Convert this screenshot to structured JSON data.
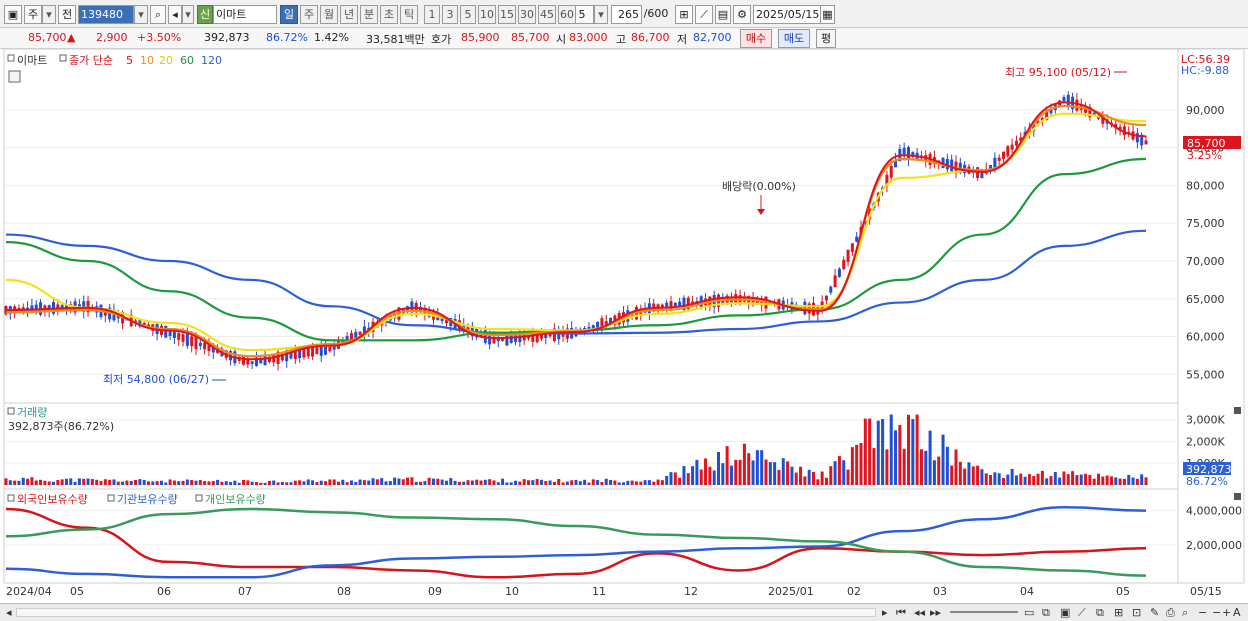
{
  "toolbar": {
    "type_label": "주",
    "prev_label": "전",
    "code": "139480",
    "new_badge": "신",
    "stock_name": "이마트",
    "periods": [
      "일",
      "주",
      "월",
      "년",
      "분",
      "초",
      "틱"
    ],
    "active_period": "일",
    "intervals": [
      "1",
      "3",
      "5",
      "10",
      "15",
      "30",
      "45",
      "60"
    ],
    "interval_value": "5",
    "count_value": "265",
    "count_total": "/600",
    "date_value": "2025/05/15"
  },
  "quote": {
    "price": "85,700",
    "up_arrow": "▲",
    "change": "2,900",
    "change_pct": "+3.50%",
    "volume": "392,873",
    "volume_ratio": "86.72%",
    "turnover_pct": "1.42%",
    "amount": "33,581백만",
    "hoga_label": "호가",
    "ask": "85,900",
    "bid": "85,700",
    "open_label": "시",
    "open": "83,000",
    "high_label": "고",
    "high": "86,700",
    "low_label": "저",
    "low": "82,700",
    "buy_label": "매수",
    "sell_label": "매도",
    "avg_label": "평"
  },
  "price_panel": {
    "legend_name": "이마트",
    "legend_ma_label": "종가 단순",
    "ma_periods": [
      "5",
      "10",
      "20",
      "60",
      "120"
    ],
    "lc_label": "LC:56.39",
    "hc_label": "HC:-9.88",
    "current_tag": "85,700",
    "current_pct": "3.25%",
    "high_annotation": "최고 95,100 (05/12)",
    "low_annotation": "최저 54,800 (06/27)",
    "dividend_annotation": "배당락(0.00%)",
    "y_ticks": [
      "90,000",
      "85,000",
      "80,000",
      "75,000",
      "70,000",
      "65,000",
      "60,000",
      "55,000"
    ]
  },
  "volume_panel": {
    "title": "거래량",
    "summary": "392,873주(86.72%)",
    "y_ticks": [
      "3,000K",
      "2,000K",
      "1,000K"
    ],
    "current_tag": "392,873",
    "current_pct": "86.72%"
  },
  "holdings_panel": {
    "legend": [
      "외국인보유수량",
      "기관보유수량",
      "개인보유수량"
    ],
    "y_ticks": [
      "4,000,000",
      "2,000,000"
    ]
  },
  "x_axis": [
    "2024/04",
    "05",
    "06",
    "07",
    "08",
    "09",
    "10",
    "11",
    "12",
    "2025/01",
    "02",
    "03",
    "04",
    "05",
    "05/15"
  ],
  "colors": {
    "ma5": "#e0141e",
    "ma10": "#f08a1e",
    "ma20": "#f2e21a",
    "ma60": "#1e9a3c",
    "ma120": "#2d5fd6",
    "up": "#e0141e",
    "down": "#1e4fd6",
    "foreign": "#d8141b",
    "institution": "#2d5fd6",
    "individual": "#3a9a5a"
  },
  "chart_data": [
    {
      "type": "line",
      "title": "",
      "series": [
        {
          "name": "종가",
          "x": [
            "2024/04",
            "05",
            "06",
            "07",
            "08",
            "09",
            "10",
            "11",
            "12",
            "2025/01",
            "02",
            "03",
            "04",
            "05",
            "05/15"
          ],
          "values": [
            63500,
            64000,
            60500,
            56500,
            58500,
            64000,
            59500,
            60500,
            64000,
            65000,
            63500,
            84500,
            81500,
            91500,
            85700
          ]
        },
        {
          "name": "5",
          "values": [
            63500,
            63800,
            60800,
            57000,
            58800,
            63800,
            59800,
            60600,
            63800,
            65200,
            63400,
            84000,
            81800,
            91000,
            86500
          ]
        },
        {
          "name": "10",
          "values": [
            63200,
            63500,
            61000,
            57400,
            59000,
            63400,
            60200,
            60700,
            63500,
            64900,
            63600,
            83500,
            82000,
            90500,
            88000
          ]
        },
        {
          "name": "20",
          "values": [
            67500,
            63800,
            61800,
            58200,
            58800,
            63000,
            61000,
            60800,
            63000,
            64400,
            64000,
            81000,
            82000,
            89500,
            88500
          ]
        },
        {
          "name": "60",
          "values": [
            72500,
            70000,
            66000,
            62500,
            59500,
            59500,
            60500,
            60800,
            61500,
            62800,
            63600,
            67500,
            73500,
            81500,
            83500
          ]
        },
        {
          "name": "120",
          "values": [
            73500,
            72000,
            70000,
            67500,
            64000,
            61500,
            60500,
            60400,
            60500,
            61000,
            62000,
            64500,
            67500,
            72000,
            74000
          ]
        }
      ],
      "ylim": [
        52000,
        97000
      ]
    },
    {
      "type": "bar",
      "title": "",
      "series": [
        {
          "name": "거래량",
          "values": [
            300,
            250,
            200,
            180,
            220,
            280,
            230,
            210,
            260,
            1600,
            450,
            3050,
            600,
            520,
            392.873
          ]
        }
      ],
      "ylim": [
        0,
        3400
      ]
    },
    {
      "type": "line",
      "title": "",
      "series": [
        {
          "name": "외국인보유수량",
          "values": [
            4100000,
            3000000,
            1000000,
            700000,
            700000,
            500000,
            100000,
            300000,
            1500000,
            500000,
            1800000,
            1600000,
            1400000,
            1600000,
            1800000
          ]
        },
        {
          "name": "기관보유수량",
          "values": [
            600000,
            300000,
            100000,
            100000,
            800000,
            1200000,
            1300000,
            1400000,
            1600000,
            1800000,
            1900000,
            2800000,
            3500000,
            4200000,
            4000000
          ]
        },
        {
          "name": "개인보유수량",
          "values": [
            2500000,
            2900000,
            3800000,
            4100000,
            3900000,
            3600000,
            3500000,
            3100000,
            2600000,
            2400000,
            2200000,
            1600000,
            700000,
            500000,
            200000
          ]
        }
      ],
      "ylim": [
        0,
        4800000
      ]
    }
  ]
}
